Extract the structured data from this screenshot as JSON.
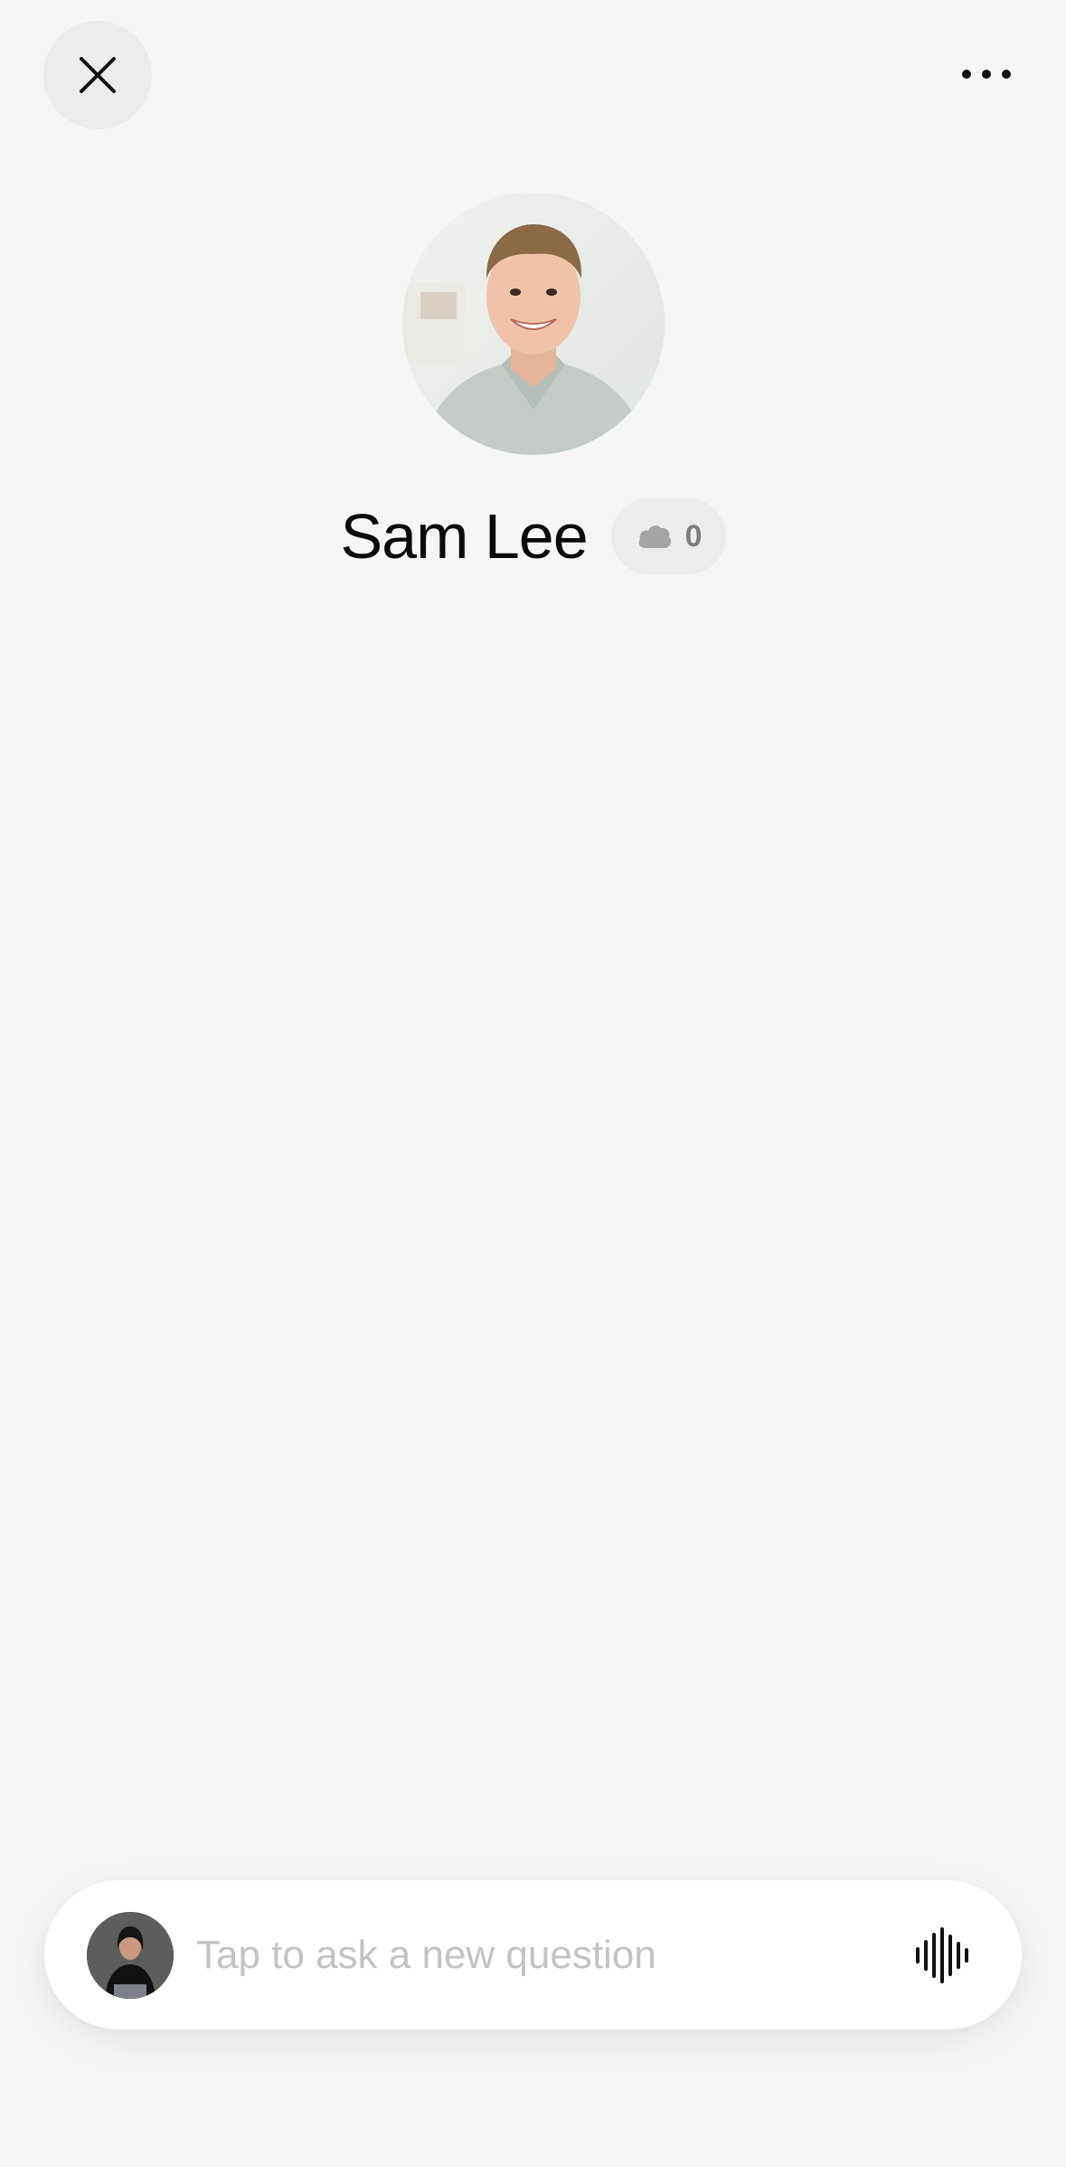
{
  "header": {
    "close_icon": "close-icon",
    "more_icon": "more-horizontal-icon"
  },
  "profile": {
    "name": "Sam Lee",
    "badge_icon": "cloud-icon",
    "badge_count": "0"
  },
  "composer": {
    "placeholder": "Tap to ask a new question",
    "voice_icon": "voice-waveform-icon"
  },
  "colors": {
    "background": "#f6f6f6",
    "close_button": "#ebebeb",
    "badge_bg": "#ececec",
    "badge_text": "#7e7e7e",
    "placeholder_text": "#c3c3c3"
  }
}
